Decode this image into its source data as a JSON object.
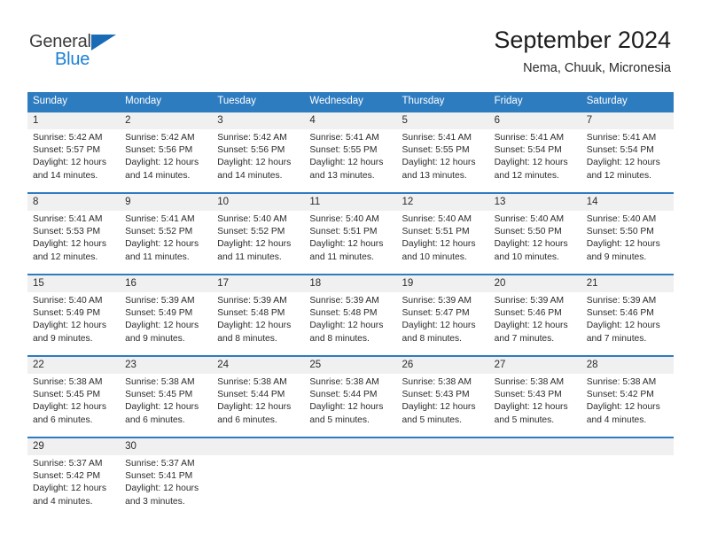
{
  "brand": {
    "name_part1": "General",
    "name_part2": "Blue",
    "accent_color": "#1a7fd4",
    "triangle_color": "#1a6bb5"
  },
  "header": {
    "title": "September 2024",
    "subtitle": "Nema, Chuuk, Micronesia"
  },
  "theme": {
    "header_band": "#2e7cc0",
    "day_number_band": "#f0f0f0",
    "text": "#2b2b2b"
  },
  "weekday_headers": [
    "Sunday",
    "Monday",
    "Tuesday",
    "Wednesday",
    "Thursday",
    "Friday",
    "Saturday"
  ],
  "weeks": [
    {
      "days": [
        {
          "number": "1",
          "sunrise": "Sunrise: 5:42 AM",
          "sunset": "Sunset: 5:57 PM",
          "daylight1": "Daylight: 12 hours",
          "daylight2": "and 14 minutes."
        },
        {
          "number": "2",
          "sunrise": "Sunrise: 5:42 AM",
          "sunset": "Sunset: 5:56 PM",
          "daylight1": "Daylight: 12 hours",
          "daylight2": "and 14 minutes."
        },
        {
          "number": "3",
          "sunrise": "Sunrise: 5:42 AM",
          "sunset": "Sunset: 5:56 PM",
          "daylight1": "Daylight: 12 hours",
          "daylight2": "and 14 minutes."
        },
        {
          "number": "4",
          "sunrise": "Sunrise: 5:41 AM",
          "sunset": "Sunset: 5:55 PM",
          "daylight1": "Daylight: 12 hours",
          "daylight2": "and 13 minutes."
        },
        {
          "number": "5",
          "sunrise": "Sunrise: 5:41 AM",
          "sunset": "Sunset: 5:55 PM",
          "daylight1": "Daylight: 12 hours",
          "daylight2": "and 13 minutes."
        },
        {
          "number": "6",
          "sunrise": "Sunrise: 5:41 AM",
          "sunset": "Sunset: 5:54 PM",
          "daylight1": "Daylight: 12 hours",
          "daylight2": "and 12 minutes."
        },
        {
          "number": "7",
          "sunrise": "Sunrise: 5:41 AM",
          "sunset": "Sunset: 5:54 PM",
          "daylight1": "Daylight: 12 hours",
          "daylight2": "and 12 minutes."
        }
      ]
    },
    {
      "days": [
        {
          "number": "8",
          "sunrise": "Sunrise: 5:41 AM",
          "sunset": "Sunset: 5:53 PM",
          "daylight1": "Daylight: 12 hours",
          "daylight2": "and 12 minutes."
        },
        {
          "number": "9",
          "sunrise": "Sunrise: 5:41 AM",
          "sunset": "Sunset: 5:52 PM",
          "daylight1": "Daylight: 12 hours",
          "daylight2": "and 11 minutes."
        },
        {
          "number": "10",
          "sunrise": "Sunrise: 5:40 AM",
          "sunset": "Sunset: 5:52 PM",
          "daylight1": "Daylight: 12 hours",
          "daylight2": "and 11 minutes."
        },
        {
          "number": "11",
          "sunrise": "Sunrise: 5:40 AM",
          "sunset": "Sunset: 5:51 PM",
          "daylight1": "Daylight: 12 hours",
          "daylight2": "and 11 minutes."
        },
        {
          "number": "12",
          "sunrise": "Sunrise: 5:40 AM",
          "sunset": "Sunset: 5:51 PM",
          "daylight1": "Daylight: 12 hours",
          "daylight2": "and 10 minutes."
        },
        {
          "number": "13",
          "sunrise": "Sunrise: 5:40 AM",
          "sunset": "Sunset: 5:50 PM",
          "daylight1": "Daylight: 12 hours",
          "daylight2": "and 10 minutes."
        },
        {
          "number": "14",
          "sunrise": "Sunrise: 5:40 AM",
          "sunset": "Sunset: 5:50 PM",
          "daylight1": "Daylight: 12 hours",
          "daylight2": "and 9 minutes."
        }
      ]
    },
    {
      "days": [
        {
          "number": "15",
          "sunrise": "Sunrise: 5:40 AM",
          "sunset": "Sunset: 5:49 PM",
          "daylight1": "Daylight: 12 hours",
          "daylight2": "and 9 minutes."
        },
        {
          "number": "16",
          "sunrise": "Sunrise: 5:39 AM",
          "sunset": "Sunset: 5:49 PM",
          "daylight1": "Daylight: 12 hours",
          "daylight2": "and 9 minutes."
        },
        {
          "number": "17",
          "sunrise": "Sunrise: 5:39 AM",
          "sunset": "Sunset: 5:48 PM",
          "daylight1": "Daylight: 12 hours",
          "daylight2": "and 8 minutes."
        },
        {
          "number": "18",
          "sunrise": "Sunrise: 5:39 AM",
          "sunset": "Sunset: 5:48 PM",
          "daylight1": "Daylight: 12 hours",
          "daylight2": "and 8 minutes."
        },
        {
          "number": "19",
          "sunrise": "Sunrise: 5:39 AM",
          "sunset": "Sunset: 5:47 PM",
          "daylight1": "Daylight: 12 hours",
          "daylight2": "and 8 minutes."
        },
        {
          "number": "20",
          "sunrise": "Sunrise: 5:39 AM",
          "sunset": "Sunset: 5:46 PM",
          "daylight1": "Daylight: 12 hours",
          "daylight2": "and 7 minutes."
        },
        {
          "number": "21",
          "sunrise": "Sunrise: 5:39 AM",
          "sunset": "Sunset: 5:46 PM",
          "daylight1": "Daylight: 12 hours",
          "daylight2": "and 7 minutes."
        }
      ]
    },
    {
      "days": [
        {
          "number": "22",
          "sunrise": "Sunrise: 5:38 AM",
          "sunset": "Sunset: 5:45 PM",
          "daylight1": "Daylight: 12 hours",
          "daylight2": "and 6 minutes."
        },
        {
          "number": "23",
          "sunrise": "Sunrise: 5:38 AM",
          "sunset": "Sunset: 5:45 PM",
          "daylight1": "Daylight: 12 hours",
          "daylight2": "and 6 minutes."
        },
        {
          "number": "24",
          "sunrise": "Sunrise: 5:38 AM",
          "sunset": "Sunset: 5:44 PM",
          "daylight1": "Daylight: 12 hours",
          "daylight2": "and 6 minutes."
        },
        {
          "number": "25",
          "sunrise": "Sunrise: 5:38 AM",
          "sunset": "Sunset: 5:44 PM",
          "daylight1": "Daylight: 12 hours",
          "daylight2": "and 5 minutes."
        },
        {
          "number": "26",
          "sunrise": "Sunrise: 5:38 AM",
          "sunset": "Sunset: 5:43 PM",
          "daylight1": "Daylight: 12 hours",
          "daylight2": "and 5 minutes."
        },
        {
          "number": "27",
          "sunrise": "Sunrise: 5:38 AM",
          "sunset": "Sunset: 5:43 PM",
          "daylight1": "Daylight: 12 hours",
          "daylight2": "and 5 minutes."
        },
        {
          "number": "28",
          "sunrise": "Sunrise: 5:38 AM",
          "sunset": "Sunset: 5:42 PM",
          "daylight1": "Daylight: 12 hours",
          "daylight2": "and 4 minutes."
        }
      ]
    },
    {
      "days": [
        {
          "number": "29",
          "sunrise": "Sunrise: 5:37 AM",
          "sunset": "Sunset: 5:42 PM",
          "daylight1": "Daylight: 12 hours",
          "daylight2": "and 4 minutes."
        },
        {
          "number": "30",
          "sunrise": "Sunrise: 5:37 AM",
          "sunset": "Sunset: 5:41 PM",
          "daylight1": "Daylight: 12 hours",
          "daylight2": "and 3 minutes."
        },
        {
          "number": "",
          "sunrise": "",
          "sunset": "",
          "daylight1": "",
          "daylight2": ""
        },
        {
          "number": "",
          "sunrise": "",
          "sunset": "",
          "daylight1": "",
          "daylight2": ""
        },
        {
          "number": "",
          "sunrise": "",
          "sunset": "",
          "daylight1": "",
          "daylight2": ""
        },
        {
          "number": "",
          "sunrise": "",
          "sunset": "",
          "daylight1": "",
          "daylight2": ""
        },
        {
          "number": "",
          "sunrise": "",
          "sunset": "",
          "daylight1": "",
          "daylight2": ""
        }
      ]
    }
  ]
}
